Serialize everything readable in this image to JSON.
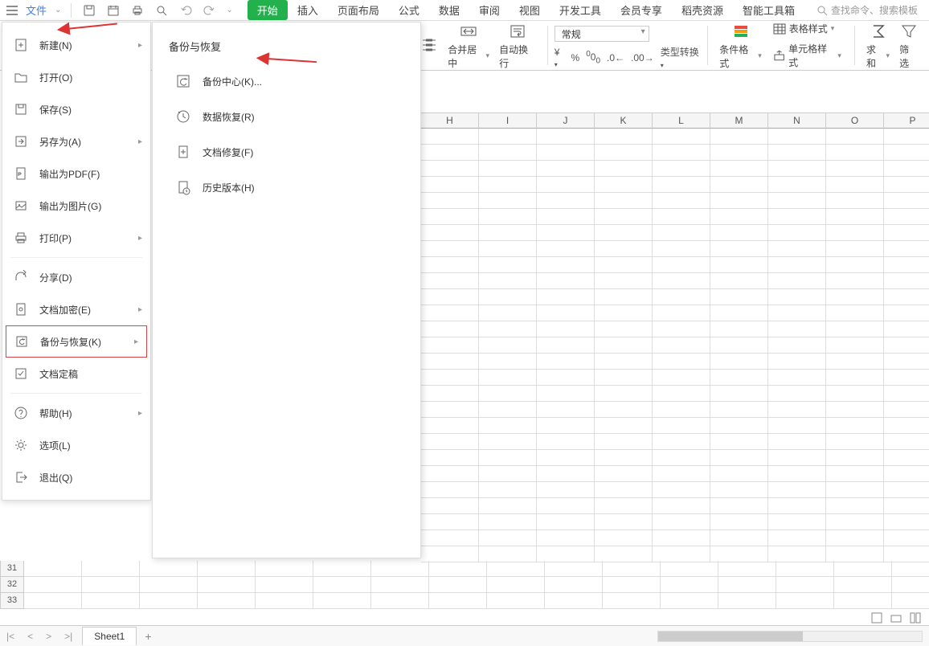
{
  "topbar": {
    "file_label": "文件",
    "tabs": [
      "开始",
      "插入",
      "页面布局",
      "公式",
      "数据",
      "审阅",
      "视图",
      "开发工具",
      "会员专享",
      "稻壳资源",
      "智能工具箱"
    ],
    "search_placeholder": "查找命令、搜索模板"
  },
  "ribbon": {
    "merge": "合并居中",
    "wrap": "自动换行",
    "format_select": "常规",
    "type_convert": "类型转换",
    "cond_format": "条件格式",
    "table_style": "表格样式",
    "cell_style": "单元格样式",
    "sum": "求和",
    "filter": "筛选"
  },
  "columns": [
    "H",
    "I",
    "J",
    "K",
    "L",
    "M",
    "N",
    "O",
    "P"
  ],
  "bottom_rows": [
    "31",
    "32",
    "33"
  ],
  "file_menu": {
    "new": "新建(N)",
    "open": "打开(O)",
    "save": "保存(S)",
    "save_as": "另存为(A)",
    "export_pdf": "输出为PDF(F)",
    "export_img": "输出为图片(G)",
    "print": "打印(P)",
    "share": "分享(D)",
    "encrypt": "文档加密(E)",
    "backup": "备份与恢复(K)",
    "finalize": "文档定稿",
    "help": "帮助(H)",
    "options": "选项(L)",
    "exit": "退出(Q)"
  },
  "submenu": {
    "title": "备份与恢复",
    "backup_center": "备份中心(K)...",
    "data_recover": "数据恢复(R)",
    "doc_repair": "文档修复(F)",
    "history": "历史版本(H)"
  },
  "sheet": {
    "name": "Sheet1"
  }
}
